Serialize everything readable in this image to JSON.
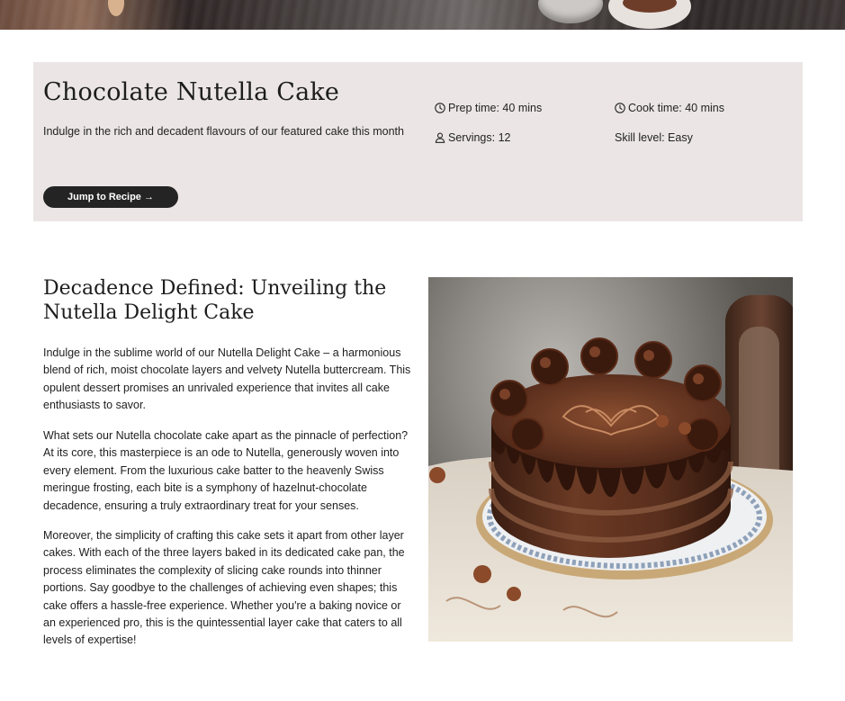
{
  "recipe": {
    "title": "Chocolate Nutella Cake",
    "subtitle": "Indulge in the rich and decadent flavours of our featured cake this month",
    "jump_label": "Jump to Recipe →",
    "prep_time": "Prep time: 40 mins",
    "cook_time": "Cook time: 40 mins",
    "servings": "Servings: 12",
    "skill_level": "Skill level: Easy"
  },
  "article": {
    "heading": "Decadence Defined: Unveiling the Nutella Delight Cake",
    "paragraphs": [
      "Indulge in the sublime world of our Nutella Delight Cake – a harmonious blend of rich, moist chocolate layers and velvety Nutella buttercream. This opulent dessert promises an unrivaled experience that invites all cake enthusiasts to savor.",
      "What sets our Nutella chocolate cake apart as the pinnacle of perfection? At its core, this masterpiece is an ode to Nutella, generously woven into every element. From the luxurious cake batter to the heavenly Swiss meringue frosting, each bite is a symphony of hazelnut-chocolate decadence, ensuring a truly extraordinary treat for your senses.",
      "Moreover, the simplicity of crafting this cake sets it apart from other layer cakes. With each of the three layers baked in its dedicated cake pan, the process eliminates the complexity of slicing cake rounds into thinner portions. Say goodbye to the challenges of achieving even shapes; this cake offers a hassle-free experience. Whether you're a baking novice or an experienced pro, this is the quintessential layer cake that caters to all levels of expertise!"
    ]
  },
  "icons": {
    "prep": "clock-icon",
    "cook": "clock-icon",
    "servings": "person-icon"
  },
  "colors": {
    "card_bg": "#ebe6e5",
    "button_bg": "#242424",
    "button_text": "#ffffff"
  }
}
